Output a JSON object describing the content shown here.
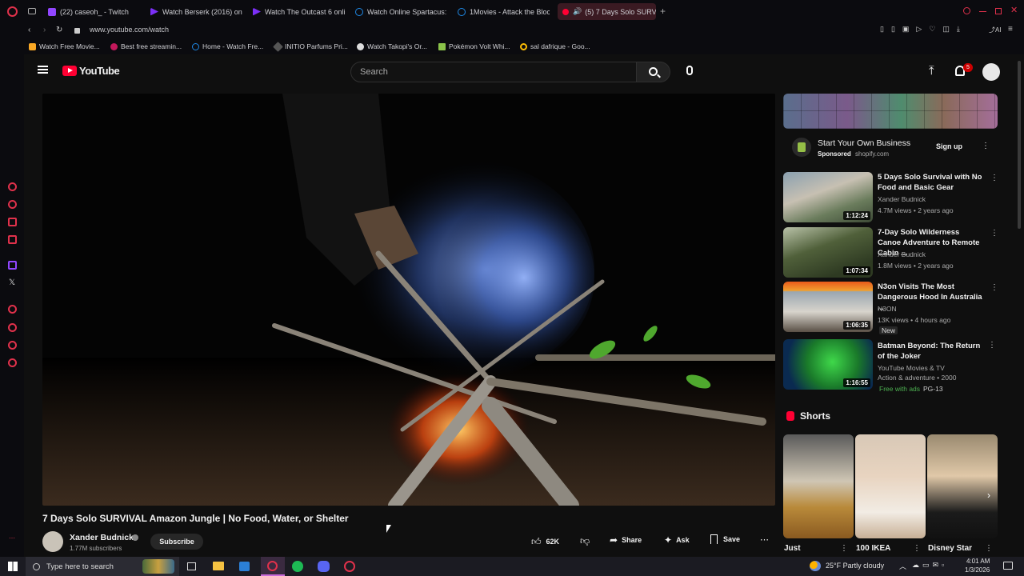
{
  "browser": {
    "tabs": [
      {
        "title": "(22) caseoh_ - Twitch",
        "color": "#9146ff"
      },
      {
        "title": "Watch Berserk (2016) onli",
        "color": "#7b2ff7"
      },
      {
        "title": "Watch The Outcast 6 onlin",
        "color": "#7b2ff7"
      },
      {
        "title": "Watch Online Spartacus: I",
        "color": "#1e88e5"
      },
      {
        "title": "1Movies - Attack the Block",
        "color": "#1e88e5"
      },
      {
        "title": "(5) 7 Days Solo SURVI",
        "color": "#ff0033"
      }
    ],
    "url": "www.youtube.com/watch",
    "bookmarks": [
      "Watch Free Movie...",
      "Best free streamin...",
      "Home - Watch Fre...",
      "INITIO Parfums Pri...",
      "Watch Takopi's Or...",
      "Pokémon Volt Whi...",
      "sal dafrique - Goo..."
    ]
  },
  "youtube": {
    "logo": "YouTube",
    "search_placeholder": "Search",
    "notification_count": "5"
  },
  "video": {
    "title": "7 Days Solo SURVIVAL Amazon Jungle | No Food, Water, or Shelter",
    "channel": "Xander Budnick",
    "subscribers": "1.77M subscribers",
    "subscribe_label": "Subscribe",
    "likes": "62K",
    "share_label": "Share",
    "ask_label": "Ask",
    "save_label": "Save"
  },
  "ad": {
    "title": "Start Your Own Business",
    "sponsored": "Sponsored",
    "domain": "shopify.com",
    "cta": "Sign up"
  },
  "recommendations": [
    {
      "title": "5 Days Solo Survival with No Food and Basic Gear",
      "channel": "Xander Budnick",
      "meta": "4.7M views • 2 years ago",
      "duration": "1:12:24",
      "extra": ""
    },
    {
      "title": "7-Day Solo Wilderness Canoe Adventure to Remote Cabin ...",
      "channel": "Xander Budnick",
      "meta": "1.8M views • 2 years ago",
      "duration": "1:07:34",
      "extra": ""
    },
    {
      "title": "N3on Visits The Most Dangerous Hood In Australia ...",
      "channel": "N3ON",
      "meta": "13K views • 4 hours ago",
      "duration": "1:06:35",
      "extra": "New"
    },
    {
      "title": "Batman Beyond: The Return of the Joker",
      "channel": "YouTube Movies & TV",
      "meta": "Action & adventure • 2000",
      "duration": "1:16:55",
      "extra": "Free with ads",
      "rating": "PG-13"
    }
  ],
  "shorts": {
    "heading": "Shorts",
    "items": [
      "Just",
      "100 IKEA",
      "Disney Star"
    ]
  },
  "taskbar": {
    "search_placeholder": "Type here to search",
    "weather": "25°F  Partly cloudy",
    "time": "4:01 AM",
    "date": "1/3/2026"
  }
}
